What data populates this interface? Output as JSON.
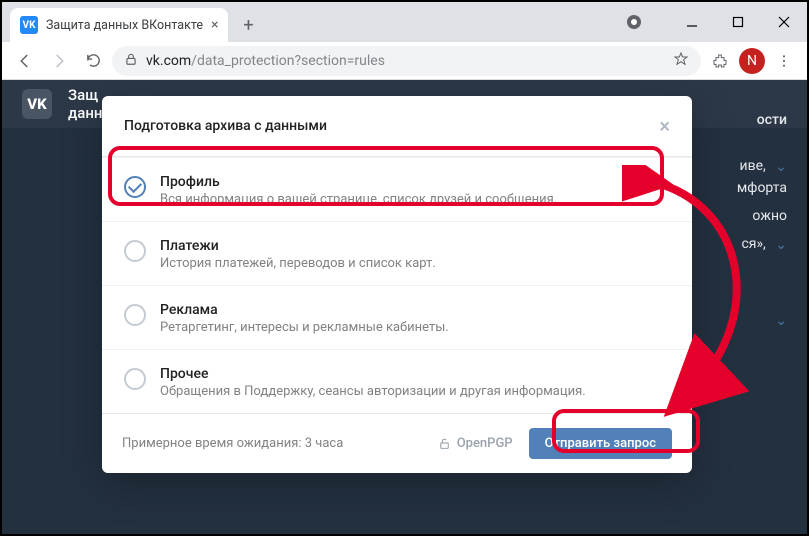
{
  "browser": {
    "tab_title": "Защита данных ВКонтакте",
    "favicon_text": "VK",
    "url_host": "vk.com",
    "url_path": "/data_protection?section=rules",
    "avatar_letter": "N"
  },
  "page": {
    "vk_logo": "VK",
    "header_line1": "Защ",
    "header_line2": "данн",
    "bg_word_topright": "ости",
    "bg_words": [
      "иве,",
      "мфорта",
      "ожно",
      "ся»,"
    ]
  },
  "modal": {
    "title": "Подготовка архива с данными",
    "options": [
      {
        "title": "Профиль",
        "desc": "Вся информация о вашей странице, список друзей и сообщения.",
        "checked": true
      },
      {
        "title": "Платежи",
        "desc": "История платежей, переводов и список карт.",
        "checked": false
      },
      {
        "title": "Реклама",
        "desc": "Ретаргетинг, интересы и рекламные кабинеты.",
        "checked": false
      },
      {
        "title": "Прочее",
        "desc": "Обращения в Поддержку, сеансы авторизации и другая информация.",
        "checked": false
      }
    ],
    "wait_label": "Примерное время ожидания:  3 часа",
    "openpgp": "OpenPGP",
    "submit": "Отправить запрос"
  }
}
